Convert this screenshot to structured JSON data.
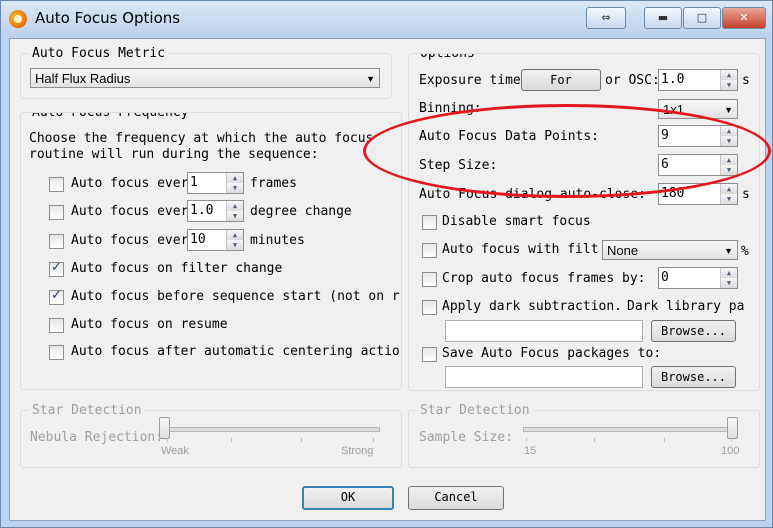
{
  "window": {
    "title": "Auto Focus Options"
  },
  "metric": {
    "legend": "Auto Focus Metric",
    "selected": "Half Flux Radius"
  },
  "frequency": {
    "legend": "Auto Focus Frequency",
    "description_line1": "Choose the frequency at which the auto focus",
    "description_line2": "routine will run during the sequence:",
    "items": [
      {
        "label": "Auto focus ever",
        "value": "1",
        "suffix": "frames",
        "checked": false
      },
      {
        "label": "Auto focus ever",
        "value": "1.0",
        "suffix": "degree change",
        "checked": false
      },
      {
        "label": "Auto focus ever",
        "value": "10",
        "suffix": "minutes",
        "checked": false
      },
      {
        "label": "Auto focus on filter change",
        "checked": true
      },
      {
        "label": "Auto focus before sequence start (not on r",
        "checked": true
      },
      {
        "label": "Auto focus on resume",
        "checked": false
      },
      {
        "label": "Auto focus after automatic centering actio",
        "checked": false
      }
    ]
  },
  "options": {
    "legend": "Options",
    "exposure_label": "Exposure time",
    "for_button": "For",
    "or_osc_label": "or OSC:",
    "exposure_value": "1.0",
    "exposure_unit": "s",
    "binning_label": "Binning:",
    "binning_value": "1x1",
    "data_points_label": "Auto Focus Data Points:",
    "data_points_value": "9",
    "step_size_label": "Step Size:",
    "step_size_value": "6",
    "autoclose_label": "Auto Focus dialog auto-close:",
    "autoclose_value": "180",
    "autoclose_unit": "s",
    "disable_smart_focus": "Disable smart focus",
    "af_with_filter_label": "Auto focus with filt",
    "af_with_filter_value": "None",
    "af_with_filter_unit": "%",
    "crop_label": "Crop auto focus frames by:",
    "crop_value": "0",
    "dark_label": "Apply dark subtraction.",
    "dark_library_label": "Dark library pa",
    "browse_label": "Browse...",
    "save_packages_label": "Save Auto Focus packages to:",
    "browse2_label": "Browse..."
  },
  "star_left": {
    "legend": "Star Detection",
    "slider_label": "Nebula Rejection:",
    "min_label": "Weak",
    "max_label": "Strong",
    "value_fraction": 0.0
  },
  "star_right": {
    "legend": "Star Detection",
    "slider_label": "Sample Size:",
    "min_label": "15",
    "max_label": "100",
    "value_fraction": 1.0
  },
  "footer": {
    "ok": "OK",
    "cancel": "Cancel"
  },
  "annotation_color": "#e3171c"
}
